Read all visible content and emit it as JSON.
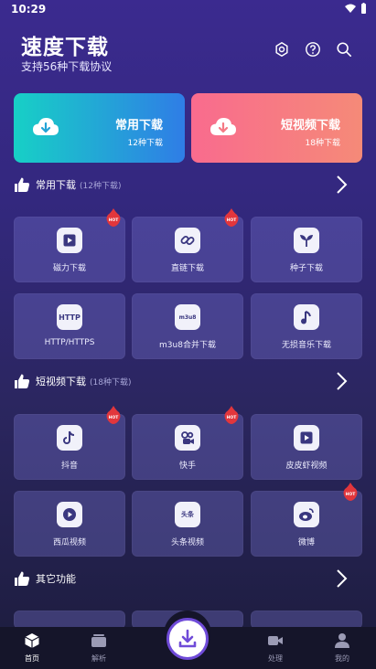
{
  "status_bar": {
    "time": "10:29"
  },
  "header": {
    "title": "速度下载",
    "subtitle": "支持56种下载协议"
  },
  "big_cards": [
    {
      "title": "常用下载",
      "count": "12种下载",
      "color_from": "#1ec8c8",
      "color_to": "#2f7fe8"
    },
    {
      "title": "短视频下载",
      "count": "18种下载",
      "color_from": "#f9718a",
      "color_to": "#f58a7a"
    }
  ],
  "sections": [
    {
      "title": "常用下载",
      "count": "(12种下载)",
      "tiles": [
        {
          "label": "磁力下载",
          "icon": "play-icon",
          "hot": true
        },
        {
          "label": "直链下载",
          "icon": "link-icon",
          "hot": true
        },
        {
          "label": "种子下载",
          "icon": "sprout-icon",
          "hot": false
        },
        {
          "label": "HTTP/HTTPS",
          "icon_text": "HTTP",
          "icon": "http-icon",
          "hot": false
        },
        {
          "label": "m3u8合并下载",
          "icon_text": "m3u8",
          "icon": "m3u8-icon",
          "hot": false
        },
        {
          "label": "无损音乐下载",
          "icon": "music-note-icon",
          "hot": false
        }
      ]
    },
    {
      "title": "短视频下载",
      "count": "(18种下载)",
      "tiles": [
        {
          "label": "抖音",
          "icon": "douyin-icon",
          "hot": true
        },
        {
          "label": "快手",
          "icon": "kuaishou-icon",
          "hot": true
        },
        {
          "label": "皮皮虾视频",
          "icon": "play-icon",
          "hot": false
        },
        {
          "label": "西瓜视频",
          "icon": "xigua-icon",
          "hot": false
        },
        {
          "label": "头条视频",
          "icon_text": "头条",
          "icon": "toutiao-icon",
          "hot": false
        },
        {
          "label": "微博",
          "icon": "weibo-icon",
          "hot": true
        }
      ]
    },
    {
      "title": "其它功能",
      "count": ""
    }
  ],
  "hot_badge": "HOT",
  "tab_bar": {
    "tabs": [
      {
        "label": "首页",
        "icon": "cube-icon",
        "active": true
      },
      {
        "label": "解析",
        "icon": "cards-icon",
        "active": false
      },
      {
        "label": "处理",
        "icon": "video-camera-icon",
        "active": false
      },
      {
        "label": "我的",
        "icon": "person-icon",
        "active": false
      }
    ]
  },
  "colors": {
    "accent": "#6f4bd8",
    "hot": "#e2363c",
    "tile_bg": "#5d5aa8"
  }
}
